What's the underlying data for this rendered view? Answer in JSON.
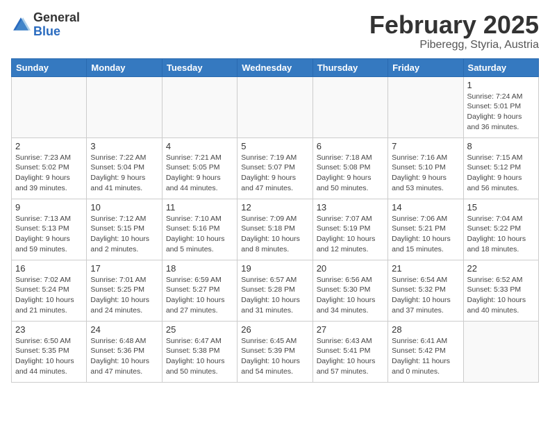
{
  "header": {
    "logo_general": "General",
    "logo_blue": "Blue",
    "month_year": "February 2025",
    "location": "Piberegg, Styria, Austria"
  },
  "calendar": {
    "days_of_week": [
      "Sunday",
      "Monday",
      "Tuesday",
      "Wednesday",
      "Thursday",
      "Friday",
      "Saturday"
    ],
    "weeks": [
      [
        {
          "day": "",
          "info": ""
        },
        {
          "day": "",
          "info": ""
        },
        {
          "day": "",
          "info": ""
        },
        {
          "day": "",
          "info": ""
        },
        {
          "day": "",
          "info": ""
        },
        {
          "day": "",
          "info": ""
        },
        {
          "day": "1",
          "info": "Sunrise: 7:24 AM\nSunset: 5:01 PM\nDaylight: 9 hours and 36 minutes."
        }
      ],
      [
        {
          "day": "2",
          "info": "Sunrise: 7:23 AM\nSunset: 5:02 PM\nDaylight: 9 hours and 39 minutes."
        },
        {
          "day": "3",
          "info": "Sunrise: 7:22 AM\nSunset: 5:04 PM\nDaylight: 9 hours and 41 minutes."
        },
        {
          "day": "4",
          "info": "Sunrise: 7:21 AM\nSunset: 5:05 PM\nDaylight: 9 hours and 44 minutes."
        },
        {
          "day": "5",
          "info": "Sunrise: 7:19 AM\nSunset: 5:07 PM\nDaylight: 9 hours and 47 minutes."
        },
        {
          "day": "6",
          "info": "Sunrise: 7:18 AM\nSunset: 5:08 PM\nDaylight: 9 hours and 50 minutes."
        },
        {
          "day": "7",
          "info": "Sunrise: 7:16 AM\nSunset: 5:10 PM\nDaylight: 9 hours and 53 minutes."
        },
        {
          "day": "8",
          "info": "Sunrise: 7:15 AM\nSunset: 5:12 PM\nDaylight: 9 hours and 56 minutes."
        }
      ],
      [
        {
          "day": "9",
          "info": "Sunrise: 7:13 AM\nSunset: 5:13 PM\nDaylight: 9 hours and 59 minutes."
        },
        {
          "day": "10",
          "info": "Sunrise: 7:12 AM\nSunset: 5:15 PM\nDaylight: 10 hours and 2 minutes."
        },
        {
          "day": "11",
          "info": "Sunrise: 7:10 AM\nSunset: 5:16 PM\nDaylight: 10 hours and 5 minutes."
        },
        {
          "day": "12",
          "info": "Sunrise: 7:09 AM\nSunset: 5:18 PM\nDaylight: 10 hours and 8 minutes."
        },
        {
          "day": "13",
          "info": "Sunrise: 7:07 AM\nSunset: 5:19 PM\nDaylight: 10 hours and 12 minutes."
        },
        {
          "day": "14",
          "info": "Sunrise: 7:06 AM\nSunset: 5:21 PM\nDaylight: 10 hours and 15 minutes."
        },
        {
          "day": "15",
          "info": "Sunrise: 7:04 AM\nSunset: 5:22 PM\nDaylight: 10 hours and 18 minutes."
        }
      ],
      [
        {
          "day": "16",
          "info": "Sunrise: 7:02 AM\nSunset: 5:24 PM\nDaylight: 10 hours and 21 minutes."
        },
        {
          "day": "17",
          "info": "Sunrise: 7:01 AM\nSunset: 5:25 PM\nDaylight: 10 hours and 24 minutes."
        },
        {
          "day": "18",
          "info": "Sunrise: 6:59 AM\nSunset: 5:27 PM\nDaylight: 10 hours and 27 minutes."
        },
        {
          "day": "19",
          "info": "Sunrise: 6:57 AM\nSunset: 5:28 PM\nDaylight: 10 hours and 31 minutes."
        },
        {
          "day": "20",
          "info": "Sunrise: 6:56 AM\nSunset: 5:30 PM\nDaylight: 10 hours and 34 minutes."
        },
        {
          "day": "21",
          "info": "Sunrise: 6:54 AM\nSunset: 5:32 PM\nDaylight: 10 hours and 37 minutes."
        },
        {
          "day": "22",
          "info": "Sunrise: 6:52 AM\nSunset: 5:33 PM\nDaylight: 10 hours and 40 minutes."
        }
      ],
      [
        {
          "day": "23",
          "info": "Sunrise: 6:50 AM\nSunset: 5:35 PM\nDaylight: 10 hours and 44 minutes."
        },
        {
          "day": "24",
          "info": "Sunrise: 6:48 AM\nSunset: 5:36 PM\nDaylight: 10 hours and 47 minutes."
        },
        {
          "day": "25",
          "info": "Sunrise: 6:47 AM\nSunset: 5:38 PM\nDaylight: 10 hours and 50 minutes."
        },
        {
          "day": "26",
          "info": "Sunrise: 6:45 AM\nSunset: 5:39 PM\nDaylight: 10 hours and 54 minutes."
        },
        {
          "day": "27",
          "info": "Sunrise: 6:43 AM\nSunset: 5:41 PM\nDaylight: 10 hours and 57 minutes."
        },
        {
          "day": "28",
          "info": "Sunrise: 6:41 AM\nSunset: 5:42 PM\nDaylight: 11 hours and 0 minutes."
        },
        {
          "day": "",
          "info": ""
        }
      ]
    ]
  }
}
